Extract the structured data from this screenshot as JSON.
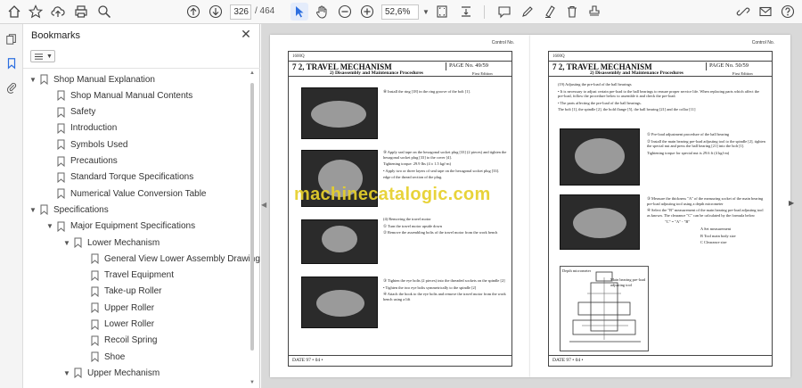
{
  "toolbar": {
    "current_page": "326",
    "total_pages": "/ 464",
    "zoom": "52,6%"
  },
  "panel": {
    "title": "Bookmarks",
    "close": "✕"
  },
  "bookmarks": [
    {
      "label": "Shop Manual Explanation",
      "level": 0,
      "expanded": true
    },
    {
      "label": "Shop Manual Manual Contents",
      "level": 1,
      "expanded": null
    },
    {
      "label": "Safety",
      "level": 1,
      "expanded": null
    },
    {
      "label": "Introduction",
      "level": 1,
      "expanded": null
    },
    {
      "label": "Symbols Used",
      "level": 1,
      "expanded": null
    },
    {
      "label": "Precautions",
      "level": 1,
      "expanded": null
    },
    {
      "label": "Standard Torque Specifications",
      "level": 1,
      "expanded": null
    },
    {
      "label": "Numerical Value Conversion Table",
      "level": 1,
      "expanded": null
    },
    {
      "label": "Specifications",
      "level": 0,
      "expanded": true
    },
    {
      "label": "Major Equipment Specifications",
      "level": 1,
      "expanded": true
    },
    {
      "label": "Lower Mechanism",
      "level": 2,
      "expanded": true
    },
    {
      "label": "General View Lower Assembly Drawing",
      "level": 3,
      "expanded": null
    },
    {
      "label": "Travel Equipment",
      "level": 3,
      "expanded": null
    },
    {
      "label": "Take-up Roller",
      "level": 3,
      "expanded": null
    },
    {
      "label": "Upper Roller",
      "level": 3,
      "expanded": null
    },
    {
      "label": "Lower Roller",
      "level": 3,
      "expanded": null
    },
    {
      "label": "Recoil Spring",
      "level": 3,
      "expanded": null
    },
    {
      "label": "Shoe",
      "level": 3,
      "expanded": null
    },
    {
      "label": "Upper Mechanism",
      "level": 2,
      "expanded": true
    }
  ],
  "pages": {
    "left": {
      "control_no": "Control No.",
      "code": "1600Q",
      "title": "7 2,   TRAVEL MECHANISM",
      "subtitle": "2)    Disassembly and Maintenance Procedures",
      "page_no": "PAGE No.  49/59",
      "edition": "First Edition",
      "date": "DATE  97 • 04 •",
      "text1": "⑧ Install the ring [18] in the ring groove of the bolt [1].",
      "text2": "⑨ Apply seal tape on the hexagonal socket plug [33] (2 pieces) and tighten the hexagonal socket plug [33] to the cover [4].",
      "text3": "Tightening torque: 29.9 Ibs (4 ± 1.5 kgf·m)",
      "text4": "• Apply two or three layers of seal tape on the hexagonal socket plug [33].",
      "text5": "edge of the thread section of the plug.",
      "text6": "(4) Removing the travel motor",
      "text7": "① Turn the travel motor upside down",
      "text8": "② Remove the assembling bolts of the travel motor from the work bench",
      "text9": "③ Tighten the eye bolts (2 pieces) into the threaded sockets on the spindle [2]",
      "text10": "• Tighten the two eye bolts symmetrically to the spindle [2]",
      "text11": "④ Attach the hook to the eye bolts and remove the travel motor from the work bench using a lift"
    },
    "right": {
      "control_no": "Control No.",
      "code": "1600Q",
      "title": "7 2,   TRAVEL MECHANISM",
      "subtitle": "2)    Disassembly and Maintenance Procedures",
      "page_no": "PAGE No.  50/59",
      "edition": "First Edition",
      "date": "DATE  97 • 04 •",
      "text1": "(19) Adjusting the pre-load of the ball bearings",
      "text2": "• It is necessary to adjust certain pre-load to the ball bearings to ensure proper service life. When replacing parts which affect the pre-load, follow the procedure below to assemble it and check the pre-load.",
      "text3": "• The parts affecting the pre-load of the ball bearings.",
      "text4": "The bolt [1], the spindle [2], the hold flange [5], the ball bearing [21] and the collar [11]",
      "text5": "① Pre-load adjustment procedure of the ball bearing",
      "text6": "② Install the main bearing pre-load adjusting tool to the spindle [2], tighten the special nut and press the ball bearing [21] into the bolt [1].",
      "text7": "Tightening torque for special nut is 29.6 ft (4 kgf·m)",
      "text8": "③ Measure the thickness \"A\" of the measuring socket of the main bearing pre-load adjusting tool using a depth micrometer",
      "text9": "④ Select the \"B\" measurement of the main bearing pre-load adjusting tool as known. The clearance \"C\" can be calculated by the formula below",
      "text10": "\"C\" = \"A\" - \"B\"",
      "text11": "A  Set measurement",
      "text12": "B  Tool main body size",
      "text13": "C  Clearance size",
      "label1": "Depth micrometer",
      "label2": "Main bearing pre-load adjusting tool"
    }
  },
  "watermark": "machinecatalogic.com"
}
